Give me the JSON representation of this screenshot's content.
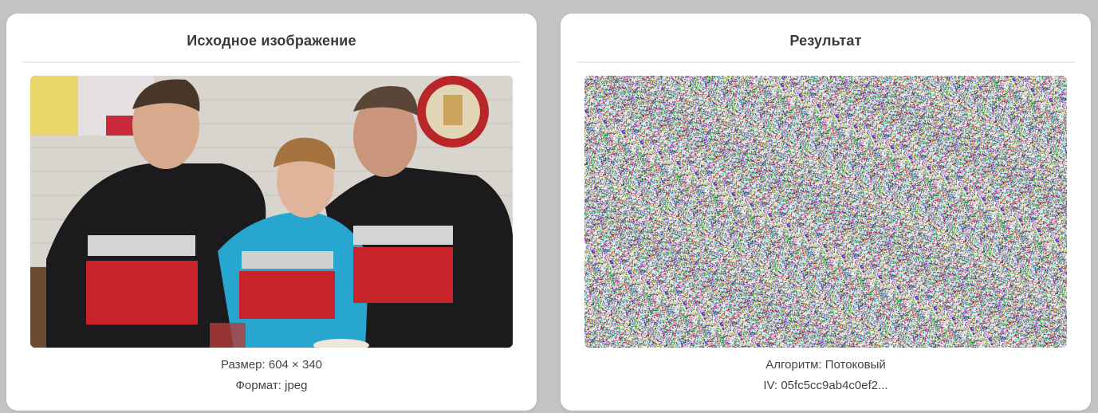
{
  "source_panel": {
    "title": "Исходное изображение",
    "image_alt": "family-photo",
    "size_text": "Размер: 604 × 340",
    "format_text": "Формат: jpeg"
  },
  "result_panel": {
    "title": "Результат",
    "image_alt": "encrypted-noise",
    "algorithm_text": "Алгоритм: Потоковый",
    "iv_text": "IV: 05fc5cc9ab4c0ef2..."
  },
  "colors": {
    "background": "#c3c3c3",
    "panel": "#ffffff",
    "shirt_black": "#1b1b1d",
    "shirt_cyan": "#27a7cf",
    "shirt_red": "#c8232a"
  }
}
